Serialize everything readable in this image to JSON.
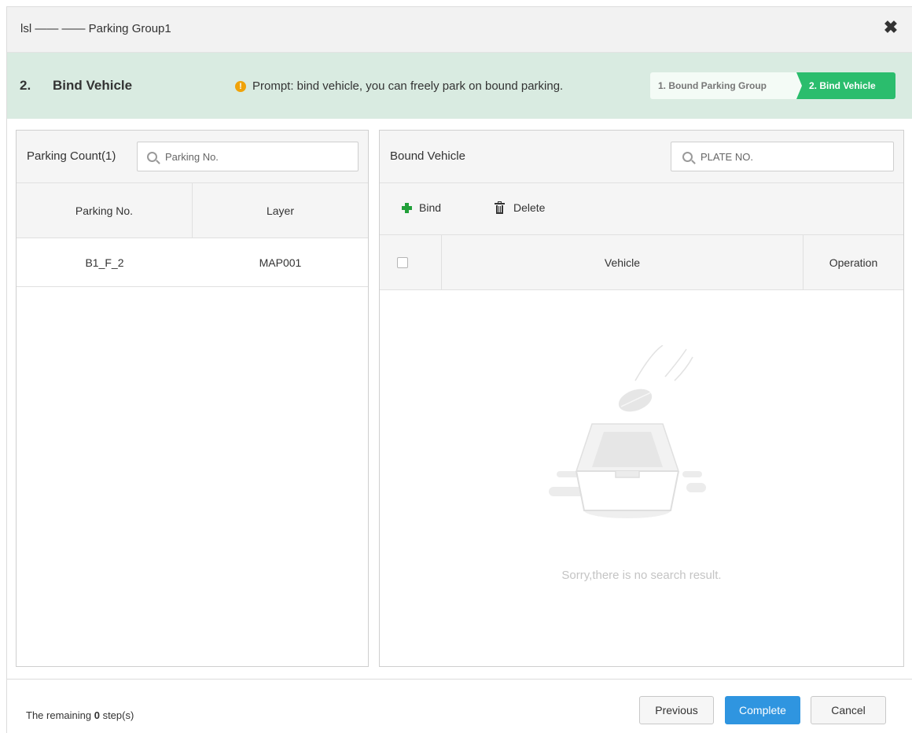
{
  "dialog": {
    "title": "lsl —— —— Parking Group1",
    "close_icon": "close-icon"
  },
  "stepbar": {
    "number": "2.",
    "title": "Bind Vehicle",
    "prompt": "Prompt: bind vehicle, you can freely park on bound parking.",
    "steps": [
      "1. Bound Parking Group",
      "2. Bind Vehicle"
    ],
    "active_color": "#2bbd6d"
  },
  "left_panel": {
    "title": "Parking Count(1)",
    "search_placeholder": "Parking No.",
    "columns": [
      "Parking No.",
      "Layer"
    ],
    "rows": [
      {
        "parking_no": "B1_F_2",
        "layer": "MAP001"
      }
    ]
  },
  "right_panel": {
    "title": "Bound Vehicle",
    "search_placeholder": "PLATE NO.",
    "toolbar": {
      "bind_label": "Bind",
      "delete_label": "Delete"
    },
    "columns": [
      "Vehicle",
      "Operation"
    ],
    "empty_text": "Sorry,there is no search result."
  },
  "footer": {
    "remaining_prefix": "The remaining ",
    "remaining_count": "0",
    "remaining_suffix": " step(s)",
    "previous_label": "Previous",
    "complete_label": "Complete",
    "cancel_label": "Cancel",
    "primary_color": "#2f95e0"
  }
}
